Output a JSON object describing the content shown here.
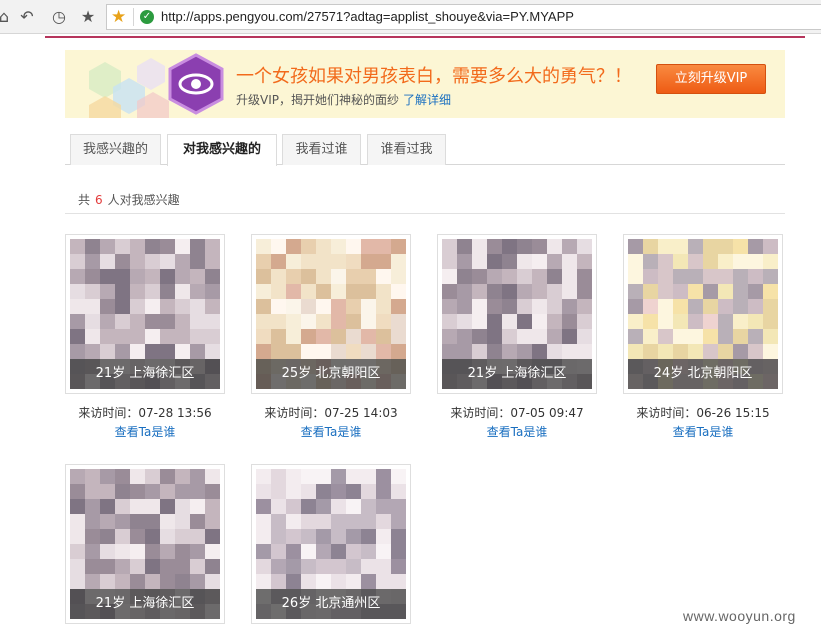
{
  "browser": {
    "url": "http://apps.pengyou.com/27571?adtag=applist_shouye&via=PY.MYAPP"
  },
  "banner": {
    "headline": "一个女孩如果对男孩表白，需要多么大的勇气？！",
    "subtext": "升级VIP，揭开她们神秘的面纱",
    "link": "了解详细",
    "button": "立刻升级VIP"
  },
  "tabs": [
    {
      "label": "我感兴趣的",
      "active": false
    },
    {
      "label": "对我感兴趣的",
      "active": true
    },
    {
      "label": "我看过谁",
      "active": false
    },
    {
      "label": "谁看过我",
      "active": false
    }
  ],
  "summary": {
    "prefix": "共",
    "count": "6",
    "suffix": "人对我感兴趣"
  },
  "cards": [
    {
      "caption": "21岁 上海徐汇区",
      "visit": "来访时间：07-28 13:56",
      "link": "查看Ta是谁"
    },
    {
      "caption": "25岁 北京朝阳区",
      "visit": "来访时间：07-25 14:03",
      "link": "查看Ta是谁"
    },
    {
      "caption": "21岁 上海徐汇区",
      "visit": "来访时间：07-05 09:47",
      "link": "查看Ta是谁"
    },
    {
      "caption": "24岁 北京朝阳区",
      "visit": "来访时间：06-26 15:15",
      "link": "查看Ta是谁"
    },
    {
      "caption": "21岁 上海徐汇区",
      "visit": "",
      "link": ""
    },
    {
      "caption": "26岁 北京通州区",
      "visit": "",
      "link": ""
    }
  ],
  "watermark": "www.wooyun.org",
  "colors": {
    "accent_orange": "#f26a1b",
    "link_blue": "#1a6fc0",
    "count_red": "#e33b3b",
    "header_rule": "#b6355c",
    "vip_purple": "#8b3fb0"
  }
}
